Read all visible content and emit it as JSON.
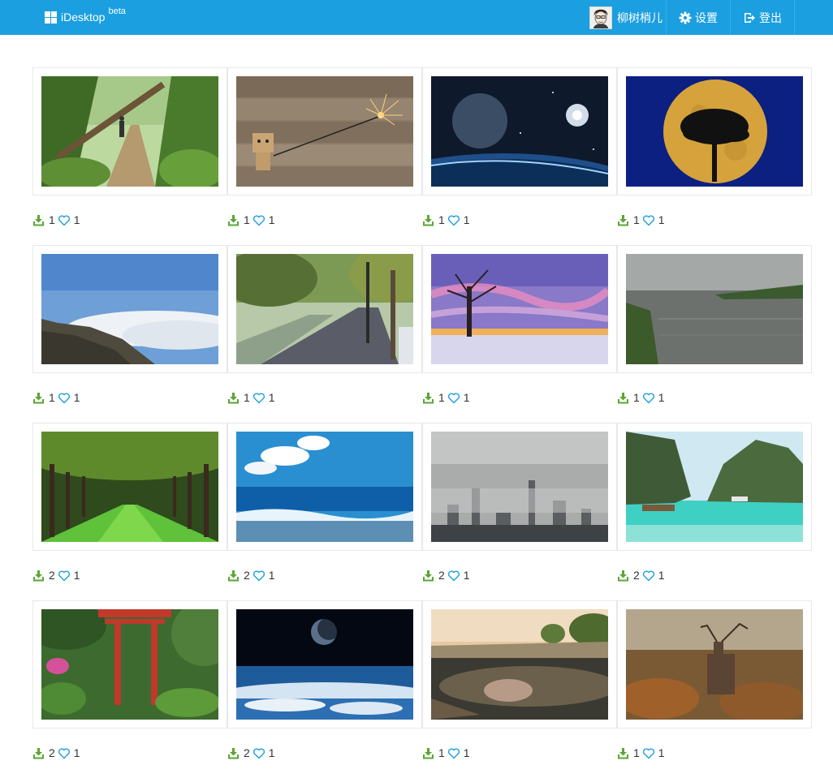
{
  "app": {
    "name": "iDesktop",
    "tag": "beta",
    "accent_color": "#1b9fe0"
  },
  "nav": {
    "user_name": "柳树梢儿",
    "settings_label": "设置",
    "logout_label": "登出"
  },
  "wallpapers": [
    {
      "scene": "forest-path-hiker",
      "downloads": "1",
      "likes": "1"
    },
    {
      "scene": "danbo-sparkler",
      "downloads": "1",
      "likes": "1"
    },
    {
      "scene": "planet-space",
      "downloads": "1",
      "likes": "1"
    },
    {
      "scene": "full-moon-tree",
      "downloads": "1",
      "likes": "1"
    },
    {
      "scene": "sea-of-clouds-cliff",
      "downloads": "1",
      "likes": "1"
    },
    {
      "scene": "tree-lined-road",
      "downloads": "1",
      "likes": "1"
    },
    {
      "scene": "dead-tree-sunset",
      "downloads": "1",
      "likes": "1"
    },
    {
      "scene": "calm-lake-dusk",
      "downloads": "1",
      "likes": "1"
    },
    {
      "scene": "green-avenue",
      "downloads": "2",
      "likes": "1"
    },
    {
      "scene": "ocean-waves",
      "downloads": "2",
      "likes": "1"
    },
    {
      "scene": "foggy-city",
      "downloads": "2",
      "likes": "1"
    },
    {
      "scene": "tropical-bay-boats",
      "downloads": "2",
      "likes": "1"
    },
    {
      "scene": "japanese-garden-torii",
      "downloads": "2",
      "likes": "1"
    },
    {
      "scene": "earth-from-space",
      "downloads": "2",
      "likes": "1"
    },
    {
      "scene": "pond-reflection",
      "downloads": "1",
      "likes": "1"
    },
    {
      "scene": "stag-in-mist",
      "downloads": "1",
      "likes": "1"
    }
  ],
  "icons": {
    "download": "download-icon",
    "like": "heart-icon"
  },
  "colors": {
    "download_icon": "#5aa634",
    "like_icon": "#1b9fe0"
  }
}
